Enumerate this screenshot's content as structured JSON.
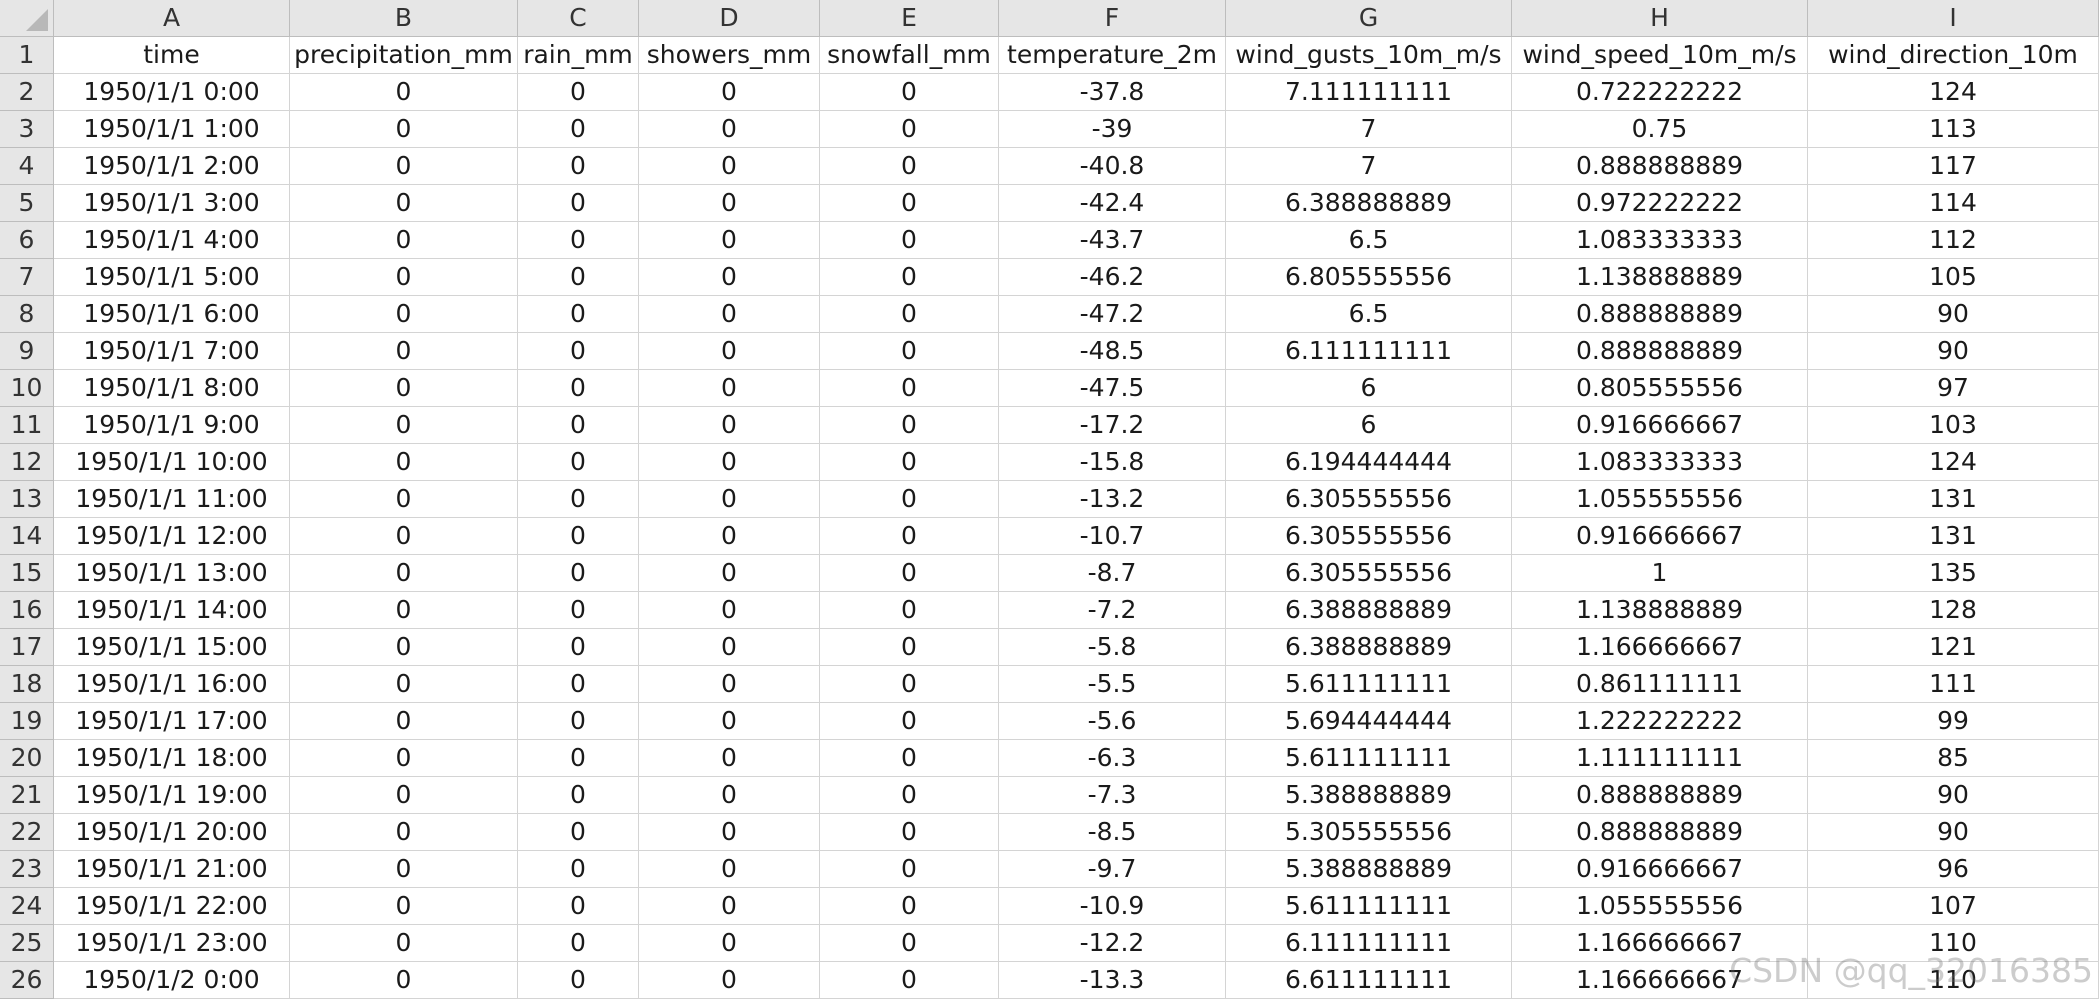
{
  "sheet": {
    "column_letters": [
      "A",
      "B",
      "C",
      "D",
      "E",
      "F",
      "G",
      "H",
      "I"
    ],
    "row_numbers": [
      "1",
      "2",
      "3",
      "4",
      "5",
      "6",
      "7",
      "8",
      "9",
      "10",
      "11",
      "12",
      "13",
      "14",
      "15",
      "16",
      "17",
      "18",
      "19",
      "20",
      "21",
      "22",
      "23",
      "24",
      "25",
      "26"
    ],
    "rows": [
      [
        "time",
        "precipitation_mm",
        "rain_mm",
        "showers_mm",
        "snowfall_mm",
        "temperature_2m",
        "wind_gusts_10m_m/s",
        "wind_speed_10m_m/s",
        "wind_direction_10m"
      ],
      [
        "1950/1/1 0:00",
        "0",
        "0",
        "0",
        "0",
        "-37.8",
        "7.111111111",
        "0.722222222",
        "124"
      ],
      [
        "1950/1/1 1:00",
        "0",
        "0",
        "0",
        "0",
        "-39",
        "7",
        "0.75",
        "113"
      ],
      [
        "1950/1/1 2:00",
        "0",
        "0",
        "0",
        "0",
        "-40.8",
        "7",
        "0.888888889",
        "117"
      ],
      [
        "1950/1/1 3:00",
        "0",
        "0",
        "0",
        "0",
        "-42.4",
        "6.388888889",
        "0.972222222",
        "114"
      ],
      [
        "1950/1/1 4:00",
        "0",
        "0",
        "0",
        "0",
        "-43.7",
        "6.5",
        "1.083333333",
        "112"
      ],
      [
        "1950/1/1 5:00",
        "0",
        "0",
        "0",
        "0",
        "-46.2",
        "6.805555556",
        "1.138888889",
        "105"
      ],
      [
        "1950/1/1 6:00",
        "0",
        "0",
        "0",
        "0",
        "-47.2",
        "6.5",
        "0.888888889",
        "90"
      ],
      [
        "1950/1/1 7:00",
        "0",
        "0",
        "0",
        "0",
        "-48.5",
        "6.111111111",
        "0.888888889",
        "90"
      ],
      [
        "1950/1/1 8:00",
        "0",
        "0",
        "0",
        "0",
        "-47.5",
        "6",
        "0.805555556",
        "97"
      ],
      [
        "1950/1/1 9:00",
        "0",
        "0",
        "0",
        "0",
        "-17.2",
        "6",
        "0.916666667",
        "103"
      ],
      [
        "1950/1/1 10:00",
        "0",
        "0",
        "0",
        "0",
        "-15.8",
        "6.194444444",
        "1.083333333",
        "124"
      ],
      [
        "1950/1/1 11:00",
        "0",
        "0",
        "0",
        "0",
        "-13.2",
        "6.305555556",
        "1.055555556",
        "131"
      ],
      [
        "1950/1/1 12:00",
        "0",
        "0",
        "0",
        "0",
        "-10.7",
        "6.305555556",
        "0.916666667",
        "131"
      ],
      [
        "1950/1/1 13:00",
        "0",
        "0",
        "0",
        "0",
        "-8.7",
        "6.305555556",
        "1",
        "135"
      ],
      [
        "1950/1/1 14:00",
        "0",
        "0",
        "0",
        "0",
        "-7.2",
        "6.388888889",
        "1.138888889",
        "128"
      ],
      [
        "1950/1/1 15:00",
        "0",
        "0",
        "0",
        "0",
        "-5.8",
        "6.388888889",
        "1.166666667",
        "121"
      ],
      [
        "1950/1/1 16:00",
        "0",
        "0",
        "0",
        "0",
        "-5.5",
        "5.611111111",
        "0.861111111",
        "111"
      ],
      [
        "1950/1/1 17:00",
        "0",
        "0",
        "0",
        "0",
        "-5.6",
        "5.694444444",
        "1.222222222",
        "99"
      ],
      [
        "1950/1/1 18:00",
        "0",
        "0",
        "0",
        "0",
        "-6.3",
        "5.611111111",
        "1.111111111",
        "85"
      ],
      [
        "1950/1/1 19:00",
        "0",
        "0",
        "0",
        "0",
        "-7.3",
        "5.388888889",
        "0.888888889",
        "90"
      ],
      [
        "1950/1/1 20:00",
        "0",
        "0",
        "0",
        "0",
        "-8.5",
        "5.305555556",
        "0.888888889",
        "90"
      ],
      [
        "1950/1/1 21:00",
        "0",
        "0",
        "0",
        "0",
        "-9.7",
        "5.388888889",
        "0.916666667",
        "96"
      ],
      [
        "1950/1/1 22:00",
        "0",
        "0",
        "0",
        "0",
        "-10.9",
        "5.611111111",
        "1.055555556",
        "107"
      ],
      [
        "1950/1/1 23:00",
        "0",
        "0",
        "0",
        "0",
        "-12.2",
        "6.111111111",
        "1.166666667",
        "110"
      ],
      [
        "1950/1/2 0:00",
        "0",
        "0",
        "0",
        "0",
        "-13.3",
        "6.611111111",
        "1.166666667",
        "110"
      ]
    ]
  },
  "watermark": "CSDN @qq_32016385"
}
